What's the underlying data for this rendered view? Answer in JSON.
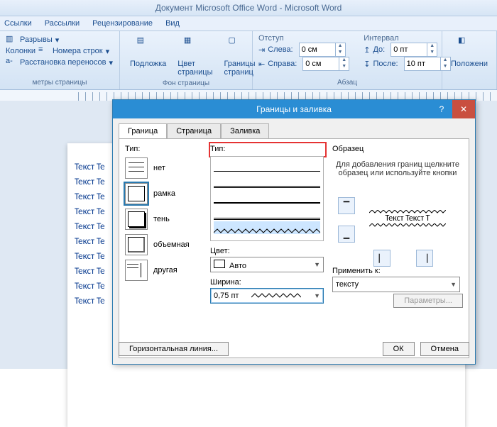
{
  "app_title": "Документ Microsoft Office Word  -  Microsoft Word",
  "menu": [
    "Ссылки",
    "Рассылки",
    "Рецензирование",
    "Вид"
  ],
  "ribbon": {
    "page_setup": {
      "breaks": "Разрывы",
      "line_numbers": "Номера строк",
      "hyphenation": "Расстановка переносов",
      "columns": "Колонки",
      "group": "метры страницы"
    },
    "bg": {
      "watermark": "Подложка",
      "page_color": "Цвет страницы",
      "page_borders": "Границы страниц",
      "group": "Фон страницы"
    },
    "indent": {
      "title": "Отступ",
      "left": "Слева:",
      "left_val": "0 см",
      "right": "Справа:",
      "right_val": "0 см"
    },
    "spacing": {
      "title": "Интервал",
      "before": "До:",
      "before_val": "0 пт",
      "after": "После:",
      "after_val": "10 пт"
    },
    "paragraph_group": "Абзац",
    "position": "Положени"
  },
  "doc_line": "Текст Те",
  "dialog": {
    "title": "Границы и заливка",
    "tabs": [
      "Граница",
      "Страница",
      "Заливка"
    ],
    "type_label": "Тип:",
    "types": [
      "нет",
      "рамка",
      "тень",
      "объемная",
      "другая"
    ],
    "style_label": "Тип:",
    "color_label": "Цвет:",
    "color_value": "Авто",
    "width_label": "Ширина:",
    "width_value": "0,75 пт",
    "preview_label": "Образец",
    "preview_hint": "Для добавления границ щелкните образец или используйте кнопки",
    "preview_sample": "Текст Текст Т",
    "apply_label": "Применить к:",
    "apply_value": "тексту",
    "params": "Параметры...",
    "hline": "Горизонтальная линия...",
    "ok": "ОК",
    "cancel": "Отмена"
  }
}
